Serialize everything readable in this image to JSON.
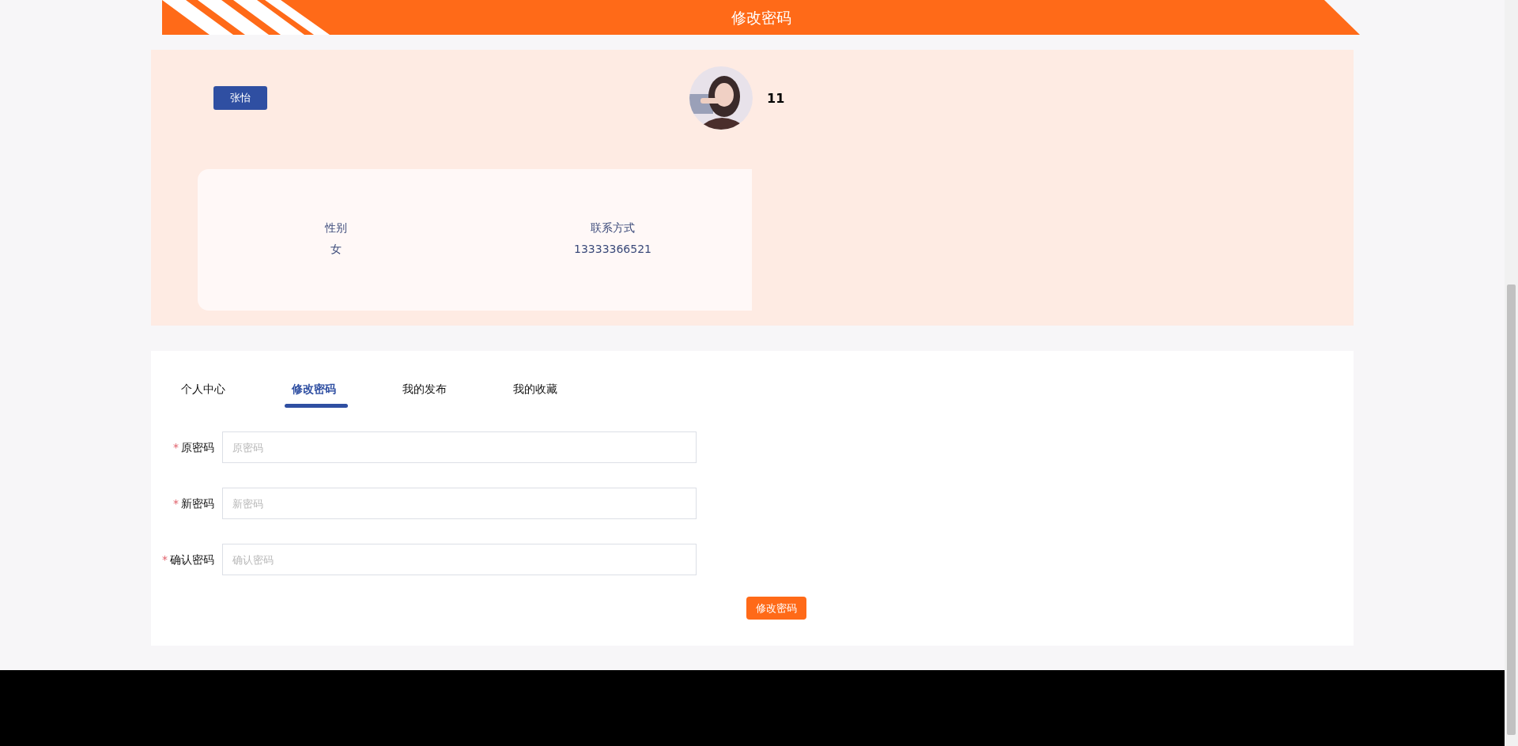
{
  "header": {
    "title": "修改密码"
  },
  "profile": {
    "name_button": "张怡",
    "username": "11",
    "info": [
      {
        "label": "性别",
        "value": "女"
      },
      {
        "label": "联系方式",
        "value": "13333366521"
      }
    ]
  },
  "tabs": [
    {
      "label": "个人中心",
      "selected": false
    },
    {
      "label": "修改密码",
      "selected": true
    },
    {
      "label": "我的发布",
      "selected": false
    },
    {
      "label": "我的收藏",
      "selected": false
    }
  ],
  "form": {
    "fields": [
      {
        "label": "原密码",
        "marker": "*",
        "placeholder": "原密码"
      },
      {
        "label": "新密码",
        "marker": "*",
        "placeholder": "新密码"
      },
      {
        "label": "确认密码",
        "marker": "*",
        "placeholder": "确认密码"
      }
    ],
    "submit": "修改密码"
  }
}
